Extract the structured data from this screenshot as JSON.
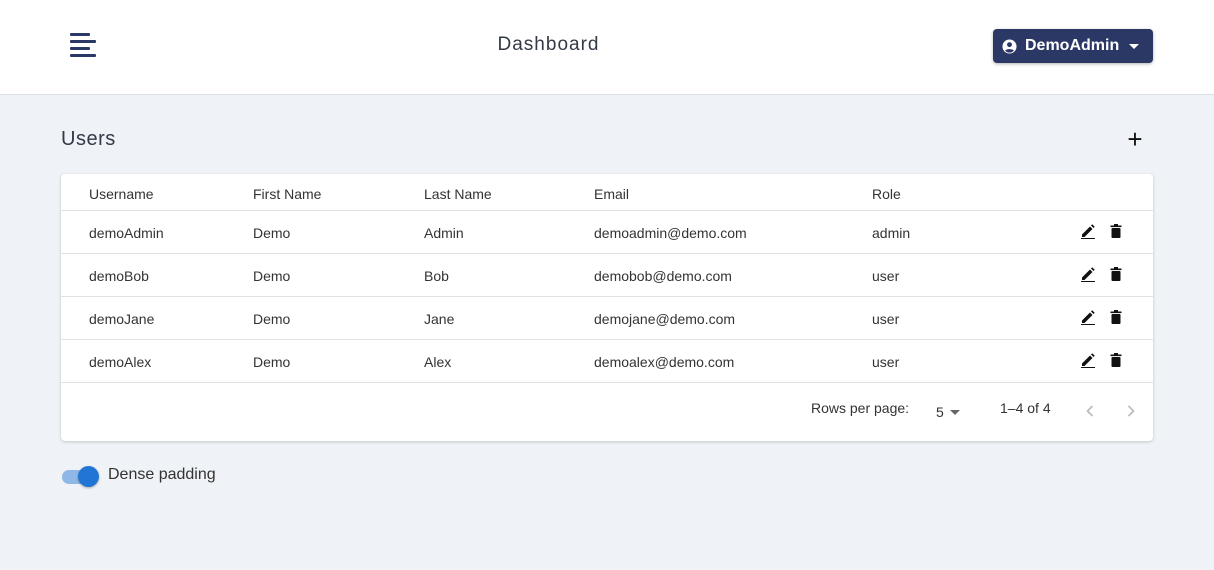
{
  "header": {
    "title": "Dashboard",
    "user_label": "DemoAdmin"
  },
  "section": {
    "title": "Users",
    "add_icon": "plus-icon"
  },
  "table": {
    "columns": [
      "Username",
      "First Name",
      "Last Name",
      "Email",
      "Role"
    ],
    "rows": [
      {
        "username": "demoAdmin",
        "first_name": "Demo",
        "last_name": "Admin",
        "email": "demoadmin@demo.com",
        "role": "admin"
      },
      {
        "username": "demoBob",
        "first_name": "Demo",
        "last_name": "Bob",
        "email": "demobob@demo.com",
        "role": "user"
      },
      {
        "username": "demoJane",
        "first_name": "Demo",
        "last_name": "Jane",
        "email": "demojane@demo.com",
        "role": "user"
      },
      {
        "username": "demoAlex",
        "first_name": "Demo",
        "last_name": "Alex",
        "email": "demoalex@demo.com",
        "role": "user"
      }
    ],
    "row_actions": [
      "pencil-icon",
      "trash-icon"
    ]
  },
  "pagination": {
    "rows_per_page_label": "Rows per page:",
    "rows_per_page_value": "5",
    "range_text": "1–4 of 4"
  },
  "dense_toggle": {
    "label": "Dense padding",
    "checked": true
  },
  "colors": {
    "brand": "#2b3866",
    "toggle_accent": "#2175d4",
    "background": "#eff2f6"
  }
}
